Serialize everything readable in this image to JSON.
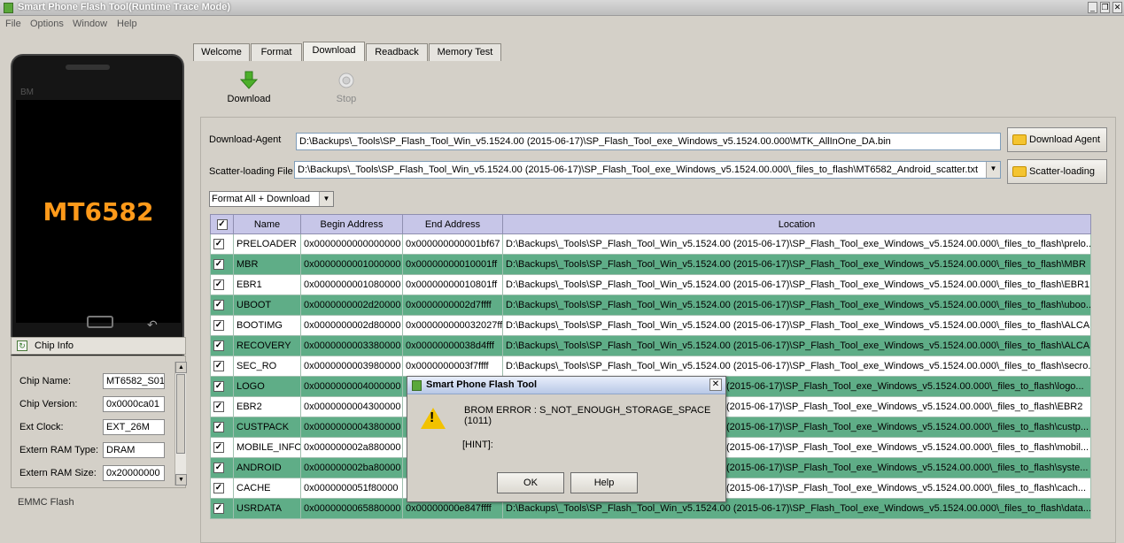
{
  "window": {
    "title": "Smart Phone Flash Tool(Runtime Trace Mode)",
    "minimize": "_",
    "restore": "❐",
    "close": "✕"
  },
  "menu": [
    "File",
    "Options",
    "Window",
    "Help"
  ],
  "phone": {
    "brand": "BM",
    "chip": "MT6582",
    "back_glyph": "↶"
  },
  "chip_info": {
    "title": "Chip Info",
    "fields": [
      {
        "label": "Chip Name:",
        "value": "MT6582_S01"
      },
      {
        "label": "Chip Version:",
        "value": "0x0000ca01"
      },
      {
        "label": "Ext Clock:",
        "value": "EXT_26M"
      },
      {
        "label": "Extern RAM Type:",
        "value": "DRAM"
      },
      {
        "label": "Extern RAM Size:",
        "value": "0x20000000"
      }
    ],
    "next_section": "EMMC Flash"
  },
  "tabs": [
    {
      "label": "Welcome"
    },
    {
      "label": "Format"
    },
    {
      "label": "Download"
    },
    {
      "label": "Readback"
    },
    {
      "label": "Memory Test"
    }
  ],
  "toolbar": {
    "download_label": "Download",
    "stop_label": "Stop"
  },
  "download_agent": {
    "label": "Download-Agent",
    "path": "D:\\Backups\\_Tools\\SP_Flash_Tool_Win_v5.1524.00 (2015-06-17)\\SP_Flash_Tool_exe_Windows_v5.1524.00.000\\MTK_AllInOne_DA.bin",
    "button": "Download Agent"
  },
  "scatter": {
    "label": "Scatter-loading File",
    "path": "D:\\Backups\\_Tools\\SP_Flash_Tool_Win_v5.1524.00 (2015-06-17)\\SP_Flash_Tool_exe_Windows_v5.1524.00.000\\_files_to_flash\\MT6582_Android_scatter.txt",
    "button": "Scatter-loading"
  },
  "mode": {
    "selected": "Format All + Download"
  },
  "table": {
    "headers": [
      "Name",
      "Begin Address",
      "End Address",
      "Location"
    ],
    "rows": [
      {
        "name": "PRELOADER",
        "begin": "0x0000000000000000",
        "end": "0x000000000001bf67",
        "location": "D:\\Backups\\_Tools\\SP_Flash_Tool_Win_v5.1524.00 (2015-06-17)\\SP_Flash_Tool_exe_Windows_v5.1524.00.000\\_files_to_flash\\prelo..."
      },
      {
        "name": "MBR",
        "begin": "0x0000000001000000",
        "end": "0x00000000010001ff",
        "location": "D:\\Backups\\_Tools\\SP_Flash_Tool_Win_v5.1524.00 (2015-06-17)\\SP_Flash_Tool_exe_Windows_v5.1524.00.000\\_files_to_flash\\MBR"
      },
      {
        "name": "EBR1",
        "begin": "0x0000000001080000",
        "end": "0x00000000010801ff",
        "location": "D:\\Backups\\_Tools\\SP_Flash_Tool_Win_v5.1524.00 (2015-06-17)\\SP_Flash_Tool_exe_Windows_v5.1524.00.000\\_files_to_flash\\EBR1"
      },
      {
        "name": "UBOOT",
        "begin": "0x0000000002d20000",
        "end": "0x0000000002d7ffff",
        "location": "D:\\Backups\\_Tools\\SP_Flash_Tool_Win_v5.1524.00 (2015-06-17)\\SP_Flash_Tool_exe_Windows_v5.1524.00.000\\_files_to_flash\\uboo..."
      },
      {
        "name": "BOOTIMG",
        "begin": "0x0000000002d80000",
        "end": "0x000000000032027ff",
        "location": "D:\\Backups\\_Tools\\SP_Flash_Tool_Win_v5.1524.00 (2015-06-17)\\SP_Flash_Tool_exe_Windows_v5.1524.00.000\\_files_to_flash\\ALCA..."
      },
      {
        "name": "RECOVERY",
        "begin": "0x0000000003380000",
        "end": "0x00000000038d4fff",
        "location": "D:\\Backups\\_Tools\\SP_Flash_Tool_Win_v5.1524.00 (2015-06-17)\\SP_Flash_Tool_exe_Windows_v5.1524.00.000\\_files_to_flash\\ALCA..."
      },
      {
        "name": "SEC_RO",
        "begin": "0x0000000003980000",
        "end": "0x0000000003f7ffff",
        "location": "D:\\Backups\\_Tools\\SP_Flash_Tool_Win_v5.1524.00 (2015-06-17)\\SP_Flash_Tool_exe_Windows_v5.1524.00.000\\_files_to_flash\\secro..."
      },
      {
        "name": "LOGO",
        "begin": "0x0000000004000000",
        "end": "",
        "location": "(2015-06-17)\\SP_Flash_Tool_exe_Windows_v5.1524.00.000\\_files_to_flash\\logo..."
      },
      {
        "name": "EBR2",
        "begin": "0x0000000004300000",
        "end": "",
        "location": "(2015-06-17)\\SP_Flash_Tool_exe_Windows_v5.1524.00.000\\_files_to_flash\\EBR2"
      },
      {
        "name": "CUSTPACK",
        "begin": "0x0000000004380000",
        "end": "",
        "location": "(2015-06-17)\\SP_Flash_Tool_exe_Windows_v5.1524.00.000\\_files_to_flash\\custp..."
      },
      {
        "name": "MOBILE_INFO",
        "begin": "0x000000002a880000",
        "end": "",
        "location": "(2015-06-17)\\SP_Flash_Tool_exe_Windows_v5.1524.00.000\\_files_to_flash\\mobil..."
      },
      {
        "name": "ANDROID",
        "begin": "0x000000002ba80000",
        "end": "",
        "location": "(2015-06-17)\\SP_Flash_Tool_exe_Windows_v5.1524.00.000\\_files_to_flash\\syste..."
      },
      {
        "name": "CACHE",
        "begin": "0x0000000051f80000",
        "end": "",
        "location": "(2015-06-17)\\SP_Flash_Tool_exe_Windows_v5.1524.00.000\\_files_to_flash\\cach..."
      },
      {
        "name": "USRDATA",
        "begin": "0x0000000065880000",
        "end": "0x00000000e847ffff",
        "location": "D:\\Backups\\_Tools\\SP_Flash_Tool_Win_v5.1524.00 (2015-06-17)\\SP_Flash_Tool_exe_Windows_v5.1524.00.000\\_files_to_flash\\data..."
      }
    ]
  },
  "dialog": {
    "title": "Smart Phone Flash Tool",
    "close": "✕",
    "warning_mark": "!",
    "message": "BROM ERROR : S_NOT_ENOUGH_STORAGE_SPACE (1011)",
    "hint": "[HINT]:",
    "ok": "OK",
    "help": "Help"
  },
  "colors": {
    "row_selected": "#5fad87",
    "header": "#c7c6e8",
    "chip_text": "#ff9a1a",
    "download_arrow": "#4caf2a"
  }
}
